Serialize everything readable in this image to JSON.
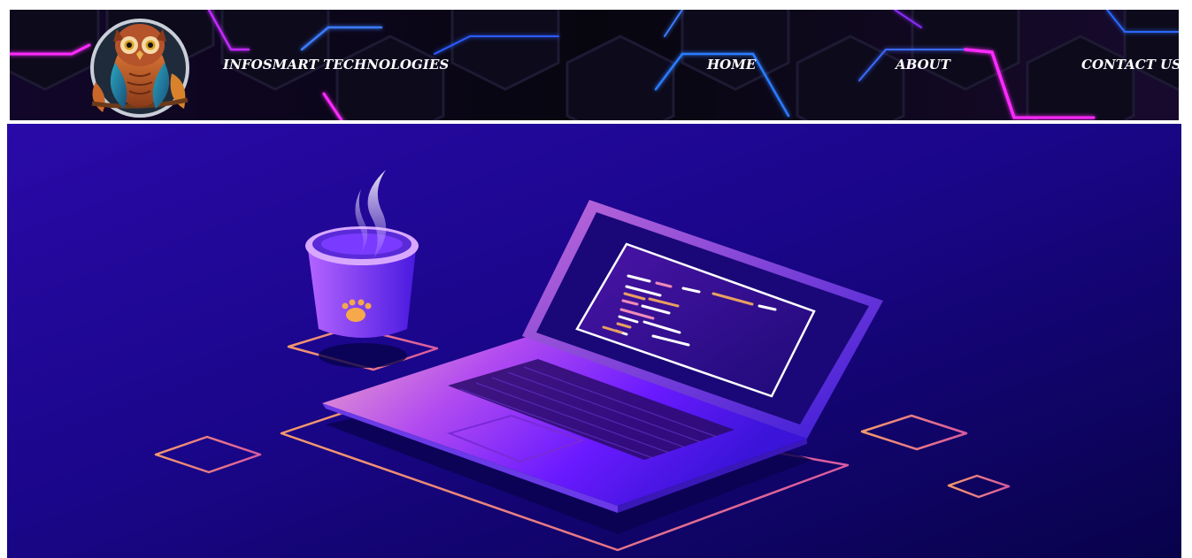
{
  "header": {
    "brand": "INFOSMART TECHNOLOGIES",
    "logo_icon": "owl-logo-icon",
    "nav": [
      {
        "label": "HOME"
      },
      {
        "label": "ABOUT"
      },
      {
        "label": "CONTACT US"
      }
    ]
  },
  "hero": {
    "illustration": "laptop-and-coffee-cup-illustration",
    "icons": [
      "laptop-icon",
      "coffee-cup-icon",
      "paw-icon",
      "steam-icon"
    ]
  },
  "colors": {
    "hero_bg_dark": "#0b0259",
    "hero_bg_mid": "#1b0a8c",
    "neon_pink": "#ff2bff",
    "neon_blue": "#2a6bff",
    "accent_gradient_start": "#f08a6e",
    "accent_gradient_end": "#d84fa0",
    "text": "#ffffff"
  }
}
